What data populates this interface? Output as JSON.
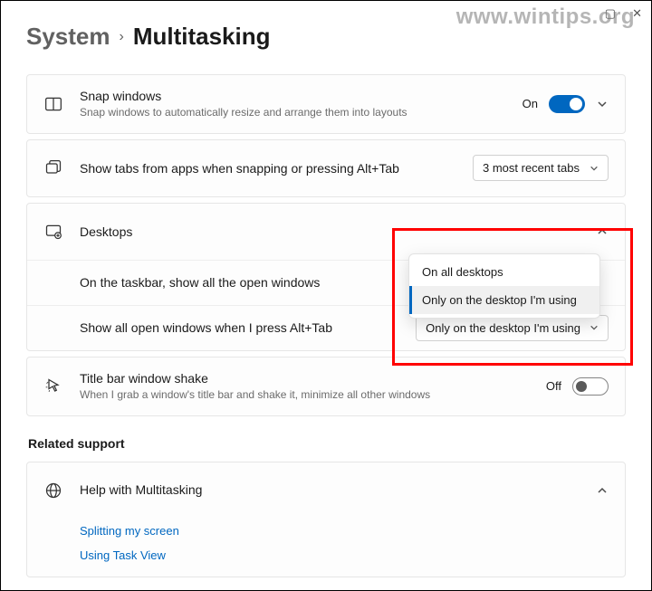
{
  "watermark": "www.wintips.org",
  "breadcrumb": {
    "parent": "System",
    "current": "Multitasking"
  },
  "snap": {
    "title": "Snap windows",
    "subtitle": "Snap windows to automatically resize and arrange them into layouts",
    "state": "On"
  },
  "tabs": {
    "title": "Show tabs from apps when snapping or pressing Alt+Tab",
    "selected": "3 most recent tabs"
  },
  "desktops": {
    "title": "Desktops",
    "row1": {
      "label": "On the taskbar, show all the open windows",
      "options": [
        "On all desktops",
        "Only on the desktop I'm using"
      ],
      "selected": "Only on the desktop I'm using"
    },
    "row2": {
      "label": "Show all open windows when I press Alt+Tab",
      "selected": "Only on the desktop I'm using"
    }
  },
  "shake": {
    "title": "Title bar window shake",
    "subtitle": "When I grab a window's title bar and shake it, minimize all other windows",
    "state": "Off"
  },
  "related": {
    "header": "Related support",
    "help_title": "Help with Multitasking",
    "links": [
      "Splitting my screen",
      "Using Task View"
    ]
  }
}
